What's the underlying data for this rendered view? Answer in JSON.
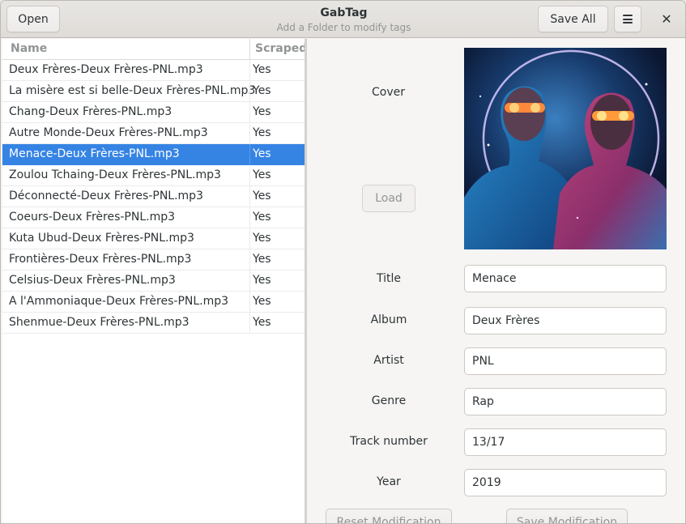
{
  "header": {
    "title": "GabTag",
    "subtitle": "Add a Folder to modify tags",
    "open_label": "Open",
    "save_all_label": "Save All",
    "menu_icon": "hamburger-icon",
    "close_icon": "close-icon",
    "close_glyph": "✕"
  },
  "file_list": {
    "headers": {
      "name": "Name",
      "scraped": "Scraped"
    },
    "rows": [
      {
        "name": "Deux Frères-Deux Frères-PNL.mp3",
        "scraped": "Yes"
      },
      {
        "name": "La misère est si belle-Deux Frères-PNL.mp3",
        "scraped": "Yes"
      },
      {
        "name": "Chang-Deux Frères-PNL.mp3",
        "scraped": "Yes"
      },
      {
        "name": "Autre Monde-Deux Frères-PNL.mp3",
        "scraped": "Yes"
      },
      {
        "name": "Menace-Deux Frères-PNL.mp3",
        "scraped": "Yes"
      },
      {
        "name": "Zoulou Tchaing-Deux Frères-PNL.mp3",
        "scraped": "Yes"
      },
      {
        "name": "Déconnecté-Deux Frères-PNL.mp3",
        "scraped": "Yes"
      },
      {
        "name": "Coeurs-Deux Frères-PNL.mp3",
        "scraped": "Yes"
      },
      {
        "name": "Kuta Ubud-Deux Frères-PNL.mp3",
        "scraped": "Yes"
      },
      {
        "name": "Frontières-Deux Frères-PNL.mp3",
        "scraped": "Yes"
      },
      {
        "name": "Celsius-Deux Frères-PNL.mp3",
        "scraped": "Yes"
      },
      {
        "name": "A l'Ammoniaque-Deux Frères-PNL.mp3",
        "scraped": "Yes"
      },
      {
        "name": "Shenmue-Deux Frères-PNL.mp3",
        "scraped": "Yes"
      }
    ],
    "selected_row": "Menace-Deux Frères-PNL.mp3"
  },
  "editor": {
    "cover_label": "Cover",
    "load_label": "Load",
    "fields": {
      "title": {
        "label": "Title",
        "value": "Menace"
      },
      "album": {
        "label": "Album",
        "value": "Deux Frères"
      },
      "artist": {
        "label": "Artist",
        "value": "PNL"
      },
      "genre": {
        "label": "Genre",
        "value": "Rap"
      },
      "track": {
        "label": "Track number",
        "value": "13/17"
      },
      "year": {
        "label": "Year",
        "value": "2019"
      }
    },
    "reset_label": "Reset Modification",
    "save_label": "Save Modification"
  },
  "colors": {
    "selection": "#3584e4",
    "header_text": "#929595"
  }
}
